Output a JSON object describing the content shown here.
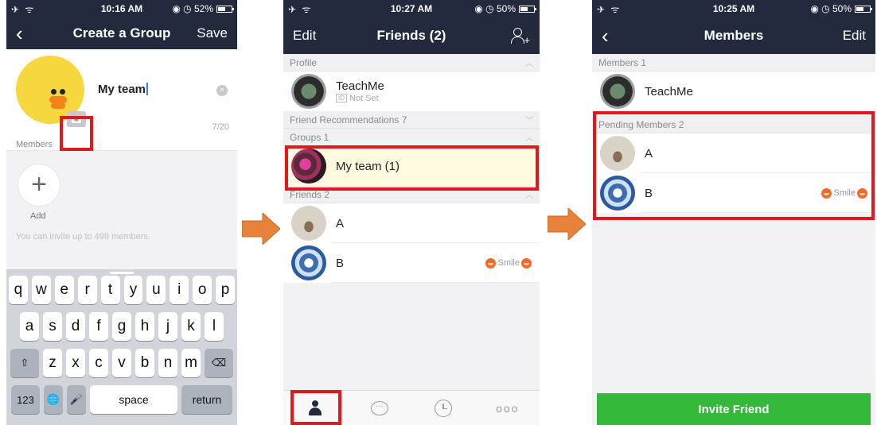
{
  "screen1": {
    "status": {
      "left": "✈ ᯤ",
      "time": "10:16 AM",
      "right": "◉ ◷ 52%"
    },
    "nav": {
      "back_icon": "chevron-left-icon",
      "title": "Create a Group",
      "save": "Save"
    },
    "group": {
      "name": "My team",
      "char_count": "7/20"
    },
    "members_label": "Members",
    "add_label": "Add",
    "hint": "You can invite up to 499 members.",
    "keyboard": {
      "row1": [
        "q",
        "w",
        "e",
        "r",
        "t",
        "y",
        "u",
        "i",
        "o",
        "p"
      ],
      "row2": [
        "a",
        "s",
        "d",
        "f",
        "g",
        "h",
        "j",
        "k",
        "l"
      ],
      "row3": [
        "z",
        "x",
        "c",
        "v",
        "b",
        "n",
        "m"
      ],
      "shift": "⇧",
      "backspace": "⌫",
      "numbers": "123",
      "globe": "🌐",
      "mic": "🎤",
      "space": "space",
      "return": "return"
    }
  },
  "screen2": {
    "status": {
      "left": "✈ ᯤ",
      "time": "10:27 AM",
      "right": "◉ ◷ 50%"
    },
    "nav": {
      "edit": "Edit",
      "title": "Friends (2)"
    },
    "sections": {
      "profile": "Profile",
      "recommendations": "Friend Recommendations 7",
      "groups": "Groups 1",
      "friends": "Friends 2"
    },
    "profile": {
      "name": "TeachMe",
      "id_tag": "ID",
      "status": "Not Set"
    },
    "group_row": {
      "name": "My team  (1)"
    },
    "friends": [
      {
        "name": "A",
        "status": ""
      },
      {
        "name": "B",
        "status": "Smile"
      }
    ]
  },
  "screen3": {
    "status": {
      "left": "✈ ᯤ",
      "time": "10:25 AM",
      "right": "◉ ◷ 50%"
    },
    "nav": {
      "title": "Members",
      "edit": "Edit"
    },
    "members_section": "Members 1",
    "member": {
      "name": "TeachMe"
    },
    "pending_section": "Pending Members 2",
    "pending": [
      {
        "name": "A",
        "status": ""
      },
      {
        "name": "B",
        "status": "Smile"
      }
    ],
    "invite_button": "Invite Friend"
  },
  "colors": {
    "nav": "#232a3e",
    "highlight": "#e01a1a",
    "arrow": "#e8823a",
    "invite": "#33b83a"
  }
}
